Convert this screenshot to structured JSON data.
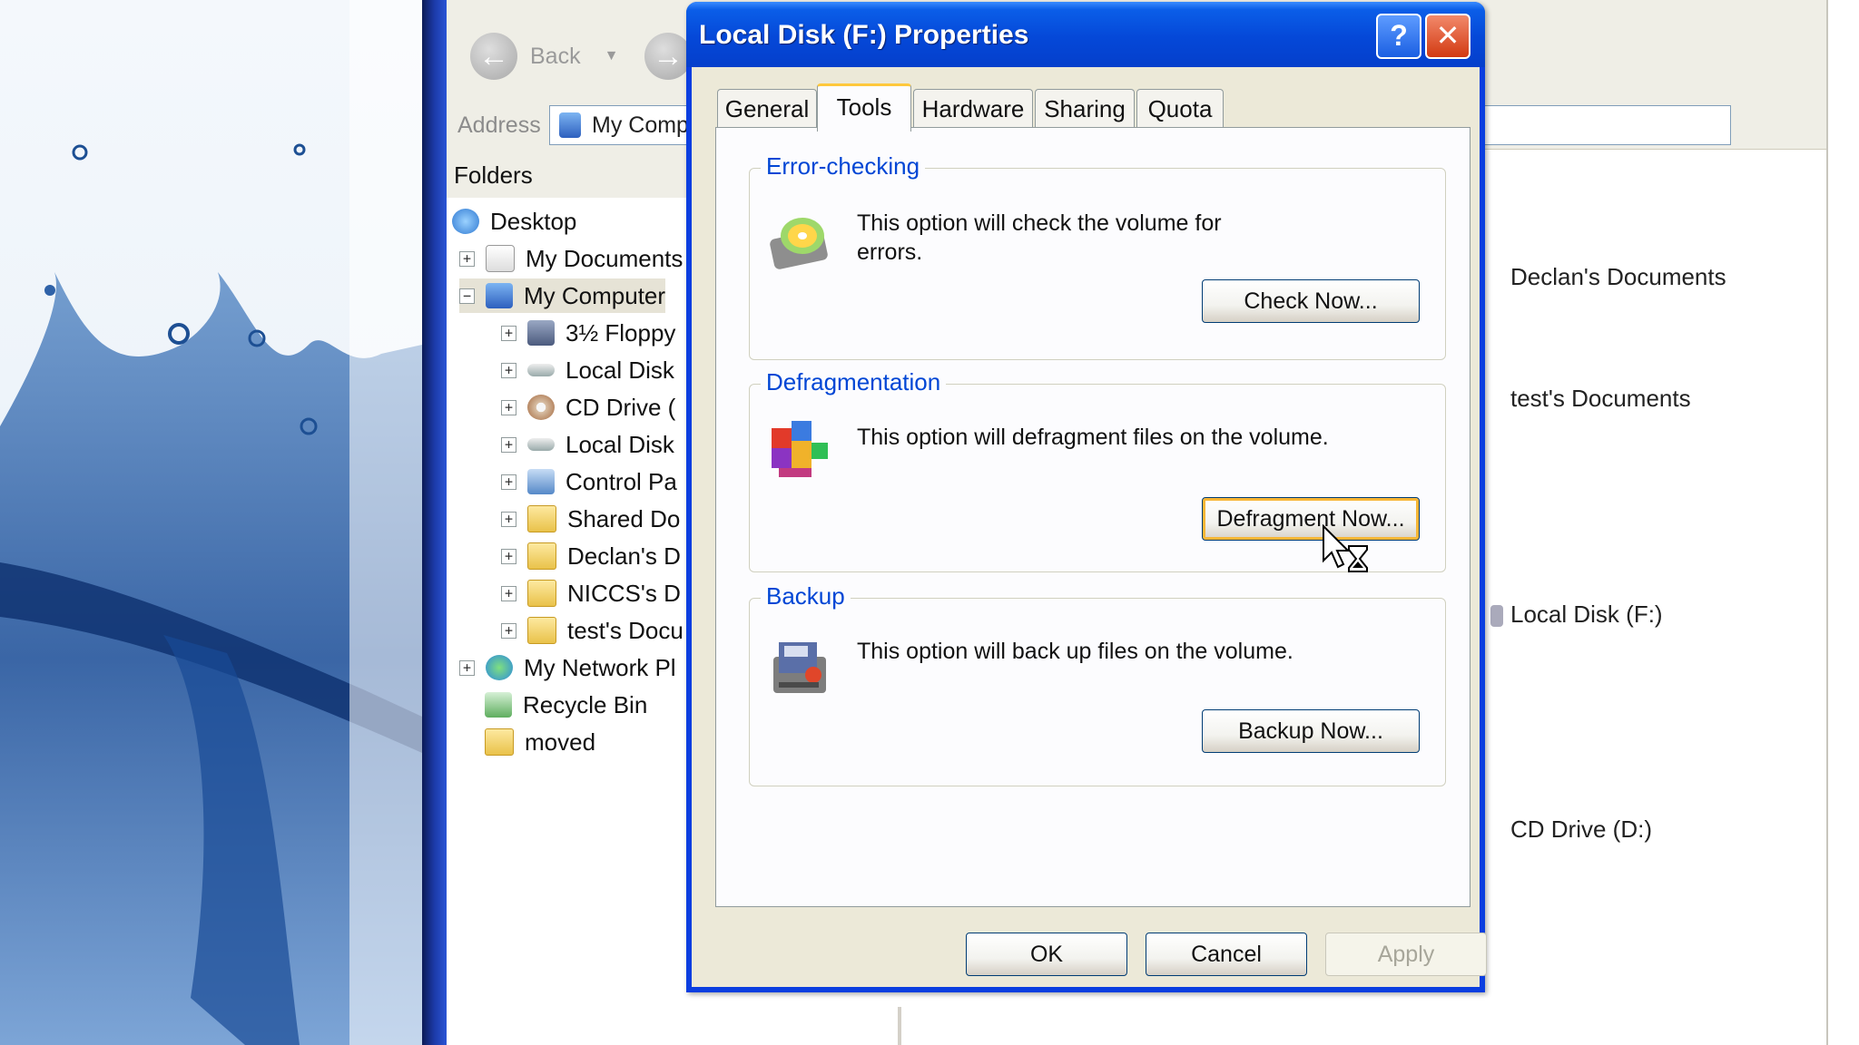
{
  "explorer": {
    "back_label": "Back",
    "address_label": "Address",
    "address_value": "My Comp",
    "folders_header": "Folders",
    "tree": [
      {
        "label": "Desktop"
      },
      {
        "label": "My Documents"
      },
      {
        "label": "My Computer"
      },
      {
        "label": "3½ Floppy"
      },
      {
        "label": "Local Disk"
      },
      {
        "label": "CD Drive ("
      },
      {
        "label": "Local Disk"
      },
      {
        "label": "Control Pa"
      },
      {
        "label": "Shared Do"
      },
      {
        "label": "Declan's D"
      },
      {
        "label": "NICCS's D"
      },
      {
        "label": "test's Docu"
      },
      {
        "label": "My Network Pl"
      },
      {
        "label": "Recycle Bin"
      },
      {
        "label": "moved"
      }
    ],
    "right_items": [
      {
        "label": "Declan's Documents"
      },
      {
        "label": "test's Documents"
      },
      {
        "label": "Local Disk (F:)"
      },
      {
        "label": "CD Drive (D:)"
      }
    ]
  },
  "dialog": {
    "title": "Local Disk (F:) Properties",
    "help_glyph": "?",
    "close_glyph": "✕",
    "tabs": [
      {
        "label": "General"
      },
      {
        "label": "Tools"
      },
      {
        "label": "Hardware"
      },
      {
        "label": "Sharing"
      },
      {
        "label": "Quota"
      }
    ],
    "active_tab": "Tools",
    "groups": {
      "error_checking": {
        "label": "Error-checking",
        "description": "This option will check the volume for errors.",
        "button": "Check Now..."
      },
      "defragmentation": {
        "label": "Defragmentation",
        "description": "This option will defragment files on the volume.",
        "button": "Defragment Now..."
      },
      "backup": {
        "label": "Backup",
        "description": "This option will back up files on the volume.",
        "button": "Backup Now..."
      }
    },
    "footer": {
      "ok": "OK",
      "cancel": "Cancel",
      "apply": "Apply"
    }
  },
  "colors": {
    "titlebar": "#0548d8",
    "group_label": "#0046d5",
    "dialog_bg": "#ece9d8",
    "focus_ring": "#f8b636"
  }
}
